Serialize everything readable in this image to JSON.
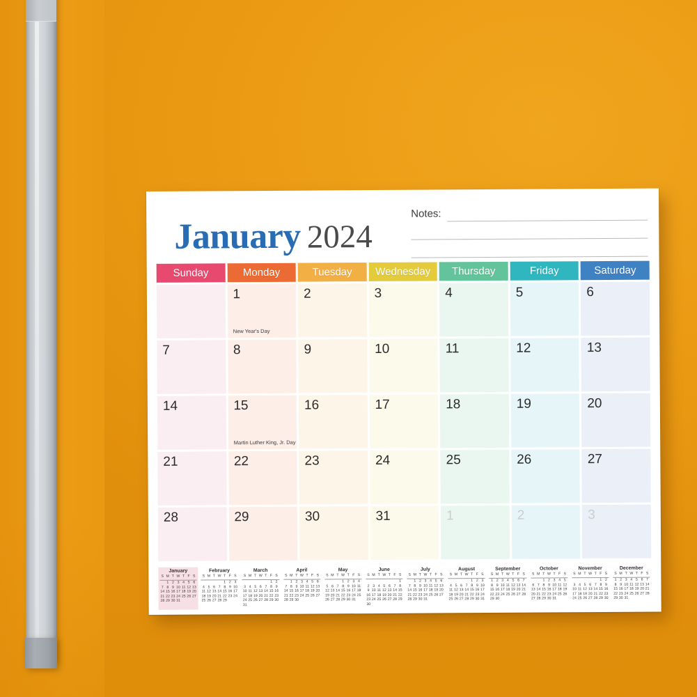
{
  "scene": {
    "background_color": "#ea9a12",
    "paper_color": "#ffffff",
    "hanger_color": "#c3c7cb"
  },
  "calendar": {
    "month": "January",
    "year": "2024",
    "title_month_color": "#2a6cb3",
    "title_year_color": "#4a4a4a",
    "notes": {
      "label": "Notes:",
      "line_count": 3
    },
    "weekdays": [
      {
        "label": "Sunday",
        "header_color": "#e8496f",
        "cell_color": "#fbeef2"
      },
      {
        "label": "Monday",
        "header_color": "#ec6a33",
        "cell_color": "#fdeee8"
      },
      {
        "label": "Tuesday",
        "header_color": "#f2af44",
        "cell_color": "#fdf6e8"
      },
      {
        "label": "Wednesday",
        "header_color": "#e3cb3b",
        "cell_color": "#fcfaea"
      },
      {
        "label": "Thursday",
        "header_color": "#63c39a",
        "cell_color": "#eaf7f0"
      },
      {
        "label": "Friday",
        "header_color": "#2fb6bf",
        "cell_color": "#e6f5f7"
      },
      {
        "label": "Saturday",
        "header_color": "#3f82c4",
        "cell_color": "#eaeff8"
      }
    ],
    "weeks": [
      [
        {
          "num": "",
          "other": false,
          "event": ""
        },
        {
          "num": "1",
          "other": false,
          "event": "New Year's Day"
        },
        {
          "num": "2",
          "other": false,
          "event": ""
        },
        {
          "num": "3",
          "other": false,
          "event": ""
        },
        {
          "num": "4",
          "other": false,
          "event": ""
        },
        {
          "num": "5",
          "other": false,
          "event": ""
        },
        {
          "num": "6",
          "other": false,
          "event": ""
        }
      ],
      [
        {
          "num": "7",
          "other": false,
          "event": ""
        },
        {
          "num": "8",
          "other": false,
          "event": ""
        },
        {
          "num": "9",
          "other": false,
          "event": ""
        },
        {
          "num": "10",
          "other": false,
          "event": ""
        },
        {
          "num": "11",
          "other": false,
          "event": ""
        },
        {
          "num": "12",
          "other": false,
          "event": ""
        },
        {
          "num": "13",
          "other": false,
          "event": ""
        }
      ],
      [
        {
          "num": "14",
          "other": false,
          "event": ""
        },
        {
          "num": "15",
          "other": false,
          "event": "Martin Luther King, Jr. Day"
        },
        {
          "num": "16",
          "other": false,
          "event": ""
        },
        {
          "num": "17",
          "other": false,
          "event": ""
        },
        {
          "num": "18",
          "other": false,
          "event": ""
        },
        {
          "num": "19",
          "other": false,
          "event": ""
        },
        {
          "num": "20",
          "other": false,
          "event": ""
        }
      ],
      [
        {
          "num": "21",
          "other": false,
          "event": ""
        },
        {
          "num": "22",
          "other": false,
          "event": ""
        },
        {
          "num": "23",
          "other": false,
          "event": ""
        },
        {
          "num": "24",
          "other": false,
          "event": ""
        },
        {
          "num": "25",
          "other": false,
          "event": ""
        },
        {
          "num": "26",
          "other": false,
          "event": ""
        },
        {
          "num": "27",
          "other": false,
          "event": ""
        }
      ],
      [
        {
          "num": "28",
          "other": false,
          "event": ""
        },
        {
          "num": "29",
          "other": false,
          "event": ""
        },
        {
          "num": "30",
          "other": false,
          "event": ""
        },
        {
          "num": "31",
          "other": false,
          "event": ""
        },
        {
          "num": "1",
          "other": true,
          "event": ""
        },
        {
          "num": "2",
          "other": true,
          "event": ""
        },
        {
          "num": "3",
          "other": true,
          "event": ""
        }
      ]
    ],
    "mini_dow": [
      "S",
      "M",
      "T",
      "W",
      "T",
      "F",
      "S"
    ],
    "mini_highlight_color": "#f7dfe6",
    "minis": [
      {
        "name": "January",
        "current": true,
        "start": 1,
        "days": 31
      },
      {
        "name": "February",
        "current": false,
        "start": 4,
        "days": 29
      },
      {
        "name": "March",
        "current": false,
        "start": 5,
        "days": 31
      },
      {
        "name": "April",
        "current": false,
        "start": 1,
        "days": 30
      },
      {
        "name": "May",
        "current": false,
        "start": 3,
        "days": 31
      },
      {
        "name": "June",
        "current": false,
        "start": 6,
        "days": 30
      },
      {
        "name": "July",
        "current": false,
        "start": 1,
        "days": 31
      },
      {
        "name": "August",
        "current": false,
        "start": 4,
        "days": 31
      },
      {
        "name": "September",
        "current": false,
        "start": 0,
        "days": 30
      },
      {
        "name": "October",
        "current": false,
        "start": 2,
        "days": 31
      },
      {
        "name": "November",
        "current": false,
        "start": 5,
        "days": 30
      },
      {
        "name": "December",
        "current": false,
        "start": 0,
        "days": 31
      }
    ]
  }
}
